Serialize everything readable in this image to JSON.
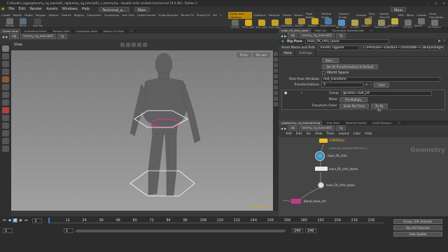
{
  "titlebar": {
    "title": "C:/Houdini_rigging/tommy_rig_tutorial/1_rig/tommy_rig_tutorial01_v_tommy.hip - Houdini Indie Limited-Commercial 19.0.383 - Python 3"
  },
  "menubar": {
    "items": [
      "File",
      "Edit",
      "Render",
      "Assets",
      "Windows",
      "Help"
    ],
    "desktop": "Technical_a...",
    "main": "Main",
    "right_main": "Main"
  },
  "shelf": {
    "tabs": [
      "Create",
      "Modify",
      "Model",
      "Polygon",
      "Deform",
      "Texture",
      "Rigging",
      "Characters",
      "Constraints",
      "Hair Utils",
      "Guide Process",
      "Guide Brushes",
      "Terrain FX",
      "Simple FX",
      "Vol",
      "+"
    ],
    "right_tabs": [
      "Lights and Cameras",
      "Collisions",
      "Particles",
      "Grains",
      "Vellum",
      "Rigid Bodies",
      "Particle Fluids",
      "Viscous Fluids",
      "Oceans",
      "Pyro FX",
      "Sparse Pyro FX",
      "FEM",
      "Wires",
      "Crowds",
      "Drive Simulation"
    ],
    "right_items": [
      "Camera",
      "Point Light",
      "Spot Light",
      "Area Light",
      "Geometry Light",
      "Volume Light",
      "Distant Light",
      "Environment Light",
      "Sky Light",
      "GI Light",
      "Caustic Light",
      "Portal Light",
      "Ambient Light",
      "Camera",
      "Stereo Camera",
      "VR Camera",
      "Switcher",
      "Gamepad Camera"
    ],
    "left_items": [
      "OBJ Info",
      "Points",
      "New Tab"
    ]
  },
  "scene_tabs": [
    "Scene View",
    "Animation Editor",
    "Render View",
    "Composite View",
    "Motion FX View",
    "+"
  ],
  "scene_path": [
    "obj",
    "tommy_rig_tutorial01",
    "rig"
  ],
  "viewport": {
    "label": "View",
    "persp": "Persp",
    "cam": "No cam",
    "indie_label": "Indie Edition"
  },
  "param_tabs": [
    "main_FK_ctrls_rpose",
    "Take List",
    "Parameter Spreadsheet",
    "+"
  ],
  "param_path": [
    "obj",
    "tommy_rig_tutorial01",
    "rig"
  ],
  "params": {
    "node_type": "Rig Pose",
    "node_name": "main_FK_ctrls_rpose",
    "asset_name_label": "Asset Name and Path",
    "asset_name": "kinefx::rigpose",
    "asset_path": "C:/PROGRA~1/SIDEEF~1/HOUDIN~1.383/packages/kin...",
    "tabs": [
      "Pose",
      "Settings"
    ],
    "bake_label": "Bake...",
    "set_all_label": "Set All Transformations to Default",
    "world_space_label": "World Space",
    "rest_pose_label": "Rest Pose Attribute",
    "rest_pose_value": "rest_transform",
    "transformations_label": "Transformations",
    "transformations_value": "3",
    "clear_label": "Clear",
    "group_label": "Group",
    "group_value": "@name=root_jnt",
    "mode_label": "Mode",
    "mode_value": "Pre-Multiply",
    "transform_order_label": "Transform Order",
    "transform_order_value": "Scale Rot Trans",
    "rot_order_value": "Rx Ry Rz"
  },
  "net_tabs": [
    "/obj/tommy_rig_tutorial01/rig",
    "Tree View",
    "Material Palette",
    "Asset Browser",
    "+"
  ],
  "net_path": [
    "obj",
    "tommy_rig_tutorial01",
    "rig"
  ],
  "net_menu": [
    "Add",
    "Edit",
    "Go",
    "View",
    "Tools",
    "Layout",
    "Labs",
    "Help"
  ],
  "network": {
    "context_label": "Geometry",
    "nodes": {
      "controls": "CONTROLS",
      "note": "Geometry_Merge/CONTROLS_0",
      "fk_ctrls": "main_FK_ctrls",
      "fk_ctrls_xform": "main_FK_ctrls_xform",
      "fk_rpose": "main_FK_ctrls_rpose",
      "blend": "blend_main_ctrl"
    }
  },
  "timeline": {
    "frame": "1",
    "start": "1",
    "end1": "240",
    "end2": "240",
    "ticks": [
      "12",
      "24",
      "36",
      "48",
      "60",
      "72",
      "84",
      "96",
      "108",
      "120",
      "132",
      "144",
      "156",
      "168",
      "180",
      "192",
      "204",
      "216",
      "228"
    ],
    "keys_label": "0 keys, 0/0 channels",
    "key_all_label": "Key All Channels",
    "auto_update": "Auto Update"
  },
  "colors": {
    "accent": "#d4a017",
    "node_selected": "#f0c020",
    "node_pink": "#c23b8a",
    "rig_green": "#2ea043"
  }
}
